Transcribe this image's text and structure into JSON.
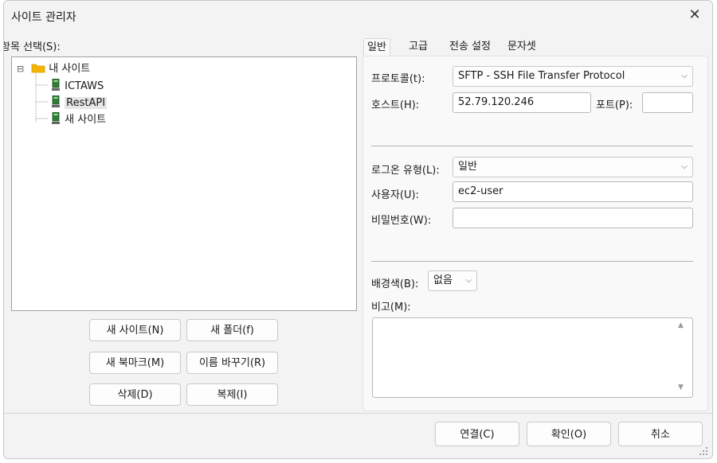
{
  "window": {
    "title": "사이트 관리자",
    "close_glyph": "✕"
  },
  "left": {
    "label": "항목 선택(S):",
    "tree": [
      {
        "label": "내 사이트",
        "kind": "folder",
        "expander": "⊟"
      },
      {
        "label": "ICTAWS",
        "kind": "site"
      },
      {
        "label": "RestAPI",
        "kind": "site"
      },
      {
        "label": "새 사이트",
        "kind": "site"
      }
    ],
    "buttons": {
      "new_site": "새 사이트(N)",
      "new_folder": "새 폴더(f)",
      "new_bookmark": "새 북마크(M)",
      "rename": "이름 바꾸기(R)",
      "delete": "삭제(D)",
      "duplicate": "복제(I)"
    }
  },
  "tabs": [
    "일반",
    "고급",
    "전송 설정",
    "문자셋"
  ],
  "general": {
    "protocol_label": "프로토콜(t):",
    "protocol_value": "SFTP - SSH File Transfer Protocol",
    "host_label": "호스트(H):",
    "host_value": "52.79.120.246",
    "port_label": "포트(P):",
    "port_value": "",
    "logon_type_label": "로그온 유형(L):",
    "logon_type_value": "일반",
    "user_label": "사용자(U):",
    "user_value": "ec2-user",
    "password_label": "비밀번호(W):",
    "password_value": "",
    "bg_color_label": "배경색(B):",
    "bg_color_value": "없음",
    "notes_label": "비고(M):",
    "notes_value": ""
  },
  "footer": {
    "connect": "연결(C)",
    "ok": "확인(O)",
    "cancel": "취소"
  },
  "icons": {
    "chevron": "⌵",
    "scroll_up": "▲",
    "scroll_down": "▼"
  },
  "colors": {
    "accent": "#0067c0",
    "folder": "#f4b400",
    "site": "#2f7d32"
  }
}
